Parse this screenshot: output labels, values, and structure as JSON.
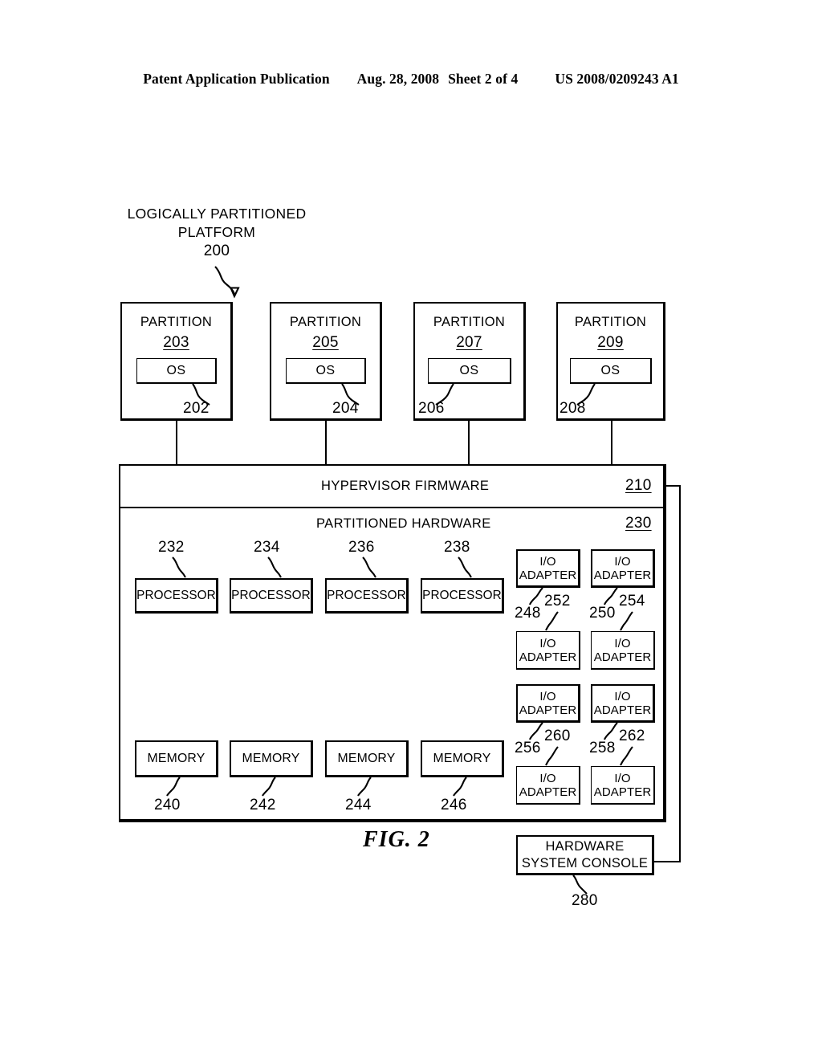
{
  "header": {
    "publication": "Patent Application Publication",
    "date": "Aug. 28, 2008",
    "sheet": "Sheet 2 of 4",
    "number": "US 2008/0209243 A1"
  },
  "figure": {
    "caption": "FIG. 2",
    "title_line1": "LOGICALLY PARTITIONED",
    "title_line2": "PLATFORM",
    "title_ref": "200"
  },
  "partitions": [
    {
      "label": "PARTITION",
      "ref": "203",
      "os_label": "OS",
      "os_ref": "202"
    },
    {
      "label": "PARTITION",
      "ref": "205",
      "os_label": "OS",
      "os_ref": "204"
    },
    {
      "label": "PARTITION",
      "ref": "207",
      "os_label": "OS",
      "os_ref": "206"
    },
    {
      "label": "PARTITION",
      "ref": "209",
      "os_label": "OS",
      "os_ref": "208"
    }
  ],
  "hypervisor": {
    "label": "HYPERVISOR FIRMWARE",
    "ref": "210"
  },
  "partitioned_hardware": {
    "label": "PARTITIONED HARDWARE",
    "ref": "230"
  },
  "processors": [
    {
      "label": "PROCESSOR",
      "ref": "232"
    },
    {
      "label": "PROCESSOR",
      "ref": "234"
    },
    {
      "label": "PROCESSOR",
      "ref": "236"
    },
    {
      "label": "PROCESSOR",
      "ref": "238"
    }
  ],
  "memories": [
    {
      "label": "MEMORY",
      "ref": "240"
    },
    {
      "label": "MEMORY",
      "ref": "242"
    },
    {
      "label": "MEMORY",
      "ref": "244"
    },
    {
      "label": "MEMORY",
      "ref": "246"
    }
  ],
  "io_adapters": [
    {
      "line1": "I/O",
      "line2": "ADAPTER",
      "ref": "248"
    },
    {
      "line1": "I/O",
      "line2": "ADAPTER",
      "ref": "250"
    },
    {
      "line1": "I/O",
      "line2": "ADAPTER",
      "ref": "252"
    },
    {
      "line1": "I/O",
      "line2": "ADAPTER",
      "ref": "254"
    },
    {
      "line1": "I/O",
      "line2": "ADAPTER",
      "ref": "256"
    },
    {
      "line1": "I/O",
      "line2": "ADAPTER",
      "ref": "258"
    },
    {
      "line1": "I/O",
      "line2": "ADAPTER",
      "ref": "260"
    },
    {
      "line1": "I/O",
      "line2": "ADAPTER",
      "ref": "262"
    }
  ],
  "console": {
    "line1": "HARDWARE",
    "line2": "SYSTEM CONSOLE",
    "ref": "280"
  },
  "colors": {
    "ink": "#000000",
    "paper": "#ffffff"
  }
}
